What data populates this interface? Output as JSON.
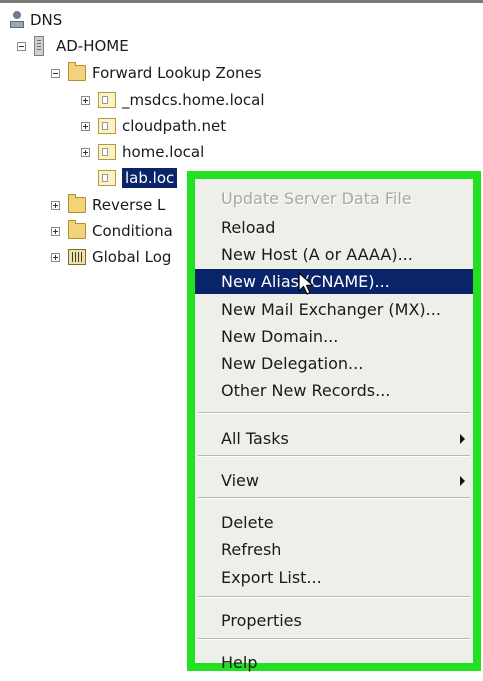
{
  "tree": {
    "root": {
      "label": "DNS",
      "icon": "dns-server-icon"
    },
    "server": {
      "label": "AD-HOME",
      "icon": "server-icon"
    },
    "forward_lookup_zones": {
      "label": "Forward Lookup Zones",
      "icon": "folder-icon"
    },
    "zones": [
      {
        "label": "_msdcs.home.local",
        "icon": "zone-icon",
        "expandable": true
      },
      {
        "label": "cloudpath.net",
        "icon": "zone-icon",
        "expandable": true
      },
      {
        "label": "home.local",
        "icon": "zone-icon",
        "expandable": true
      },
      {
        "label": "lab.loc",
        "icon": "zone-icon",
        "expandable": false,
        "selected": true
      }
    ],
    "other_folders": [
      {
        "label": "Reverse L",
        "icon": "folder-icon"
      },
      {
        "label": "Conditiona",
        "icon": "folder-icon"
      },
      {
        "label": "Global Log",
        "icon": "global-logs-icon"
      }
    ]
  },
  "context_menu": {
    "items": [
      {
        "label": "Update Server Data File",
        "disabled": true
      },
      {
        "label": "Reload"
      },
      {
        "label": "New Host (A or AAAA)..."
      },
      {
        "label": "New Alias (CNAME)...",
        "highlighted": true
      },
      {
        "label": "New Mail Exchanger (MX)..."
      },
      {
        "label": "New Domain..."
      },
      {
        "label": "New Delegation..."
      },
      {
        "label": "Other New Records..."
      },
      {
        "separator": true
      },
      {
        "label": "All Tasks",
        "submenu": true
      },
      {
        "separator": true
      },
      {
        "label": "View",
        "submenu": true
      },
      {
        "separator": true
      },
      {
        "label": "Delete"
      },
      {
        "label": "Refresh"
      },
      {
        "label": "Export List..."
      },
      {
        "separator": true
      },
      {
        "label": "Properties"
      },
      {
        "separator": true
      },
      {
        "label": "Help"
      }
    ],
    "highlight_border_color": "#22e022",
    "selection_color": "#0a246a"
  }
}
